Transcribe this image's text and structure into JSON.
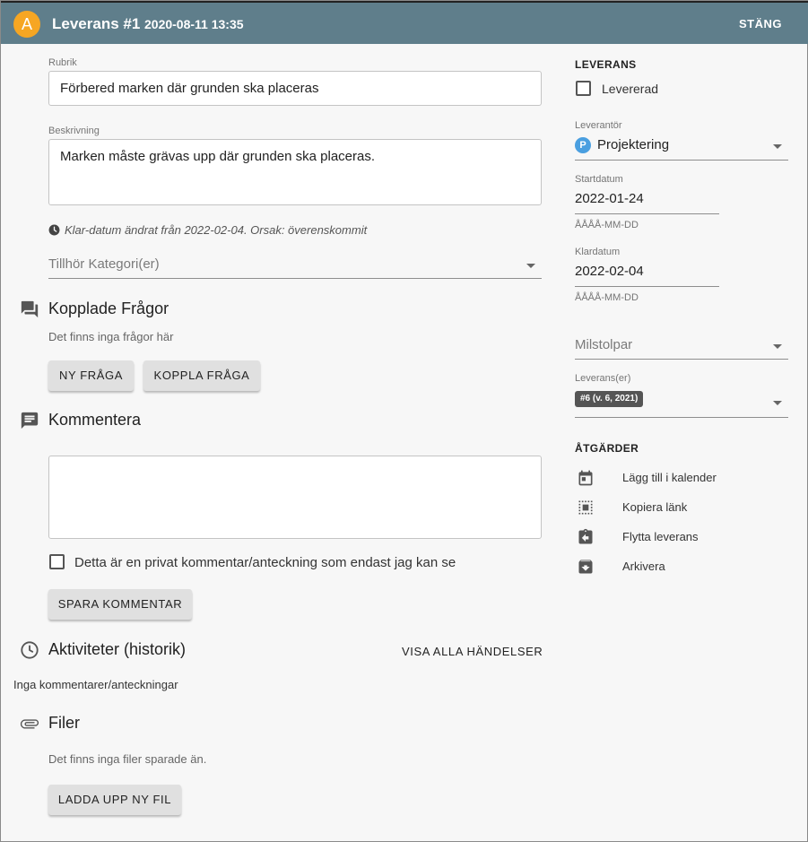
{
  "header": {
    "avatar_letter": "A",
    "title": "Leverans #1",
    "datetime": "2020-08-11 13:35",
    "close_label": "STÄNG"
  },
  "form": {
    "rubrik_label": "Rubrik",
    "rubrik_value": "Förbered marken där grunden ska placeras",
    "beskrivning_label": "Beskrivning",
    "beskrivning_value": "Marken måste grävas upp där grunden ska placeras.",
    "date_change_note": "Klar-datum ändrat från 2022-02-04. Orsak: överenskommit",
    "kategori_placeholder": "Tillhör Kategori(er)"
  },
  "fragor": {
    "title": "Kopplade Frågor",
    "empty_text": "Det finns inga frågor här",
    "new_button": "NY FRÅGA",
    "link_button": "KOPPLA FRÅGA"
  },
  "kommentera": {
    "title": "Kommentera",
    "comment_value": "",
    "private_label": "Detta är en privat kommentar/anteckning som endast jag kan se",
    "save_button": "SPARA KOMMENTAR"
  },
  "aktiviteter": {
    "title": "Aktiviteter (historik)",
    "show_all_button": "VISA ALLA HÄNDELSER",
    "empty_text": "Inga kommentarer/anteckningar"
  },
  "filer": {
    "title": "Filer",
    "empty_text": "Det finns inga filer sparade än.",
    "upload_button": "LADDA UPP NY FIL"
  },
  "leverans": {
    "heading": "LEVERANS",
    "delivered_label": "Levererad",
    "supplier_label": "Leverantör",
    "supplier_badge": "P",
    "supplier_value": "Projektering",
    "start_label": "Startdatum",
    "start_value": "2022-01-24",
    "start_hint": "ÅÅÅÅ-MM-DD",
    "end_label": "Klardatum",
    "end_value": "2022-02-04",
    "end_hint": "ÅÅÅÅ-MM-DD",
    "milestone_placeholder": "Milstolpar",
    "deliveries_label": "Leverans(er)",
    "delivery_chip": "#6 (v. 6, 2021)"
  },
  "atgarder": {
    "heading": "ÅTGÄRDER",
    "items": [
      {
        "label": "Lägg till i kalender",
        "icon": "calendar-icon"
      },
      {
        "label": "Kopiera länk",
        "icon": "copy-link-icon"
      },
      {
        "label": "Flytta leverans",
        "icon": "move-icon"
      },
      {
        "label": "Arkivera",
        "icon": "archive-icon"
      }
    ]
  },
  "colors": {
    "header_bg": "#5f7e8b",
    "avatar": "#f6a623",
    "supplier_dot": "#4a9fe0",
    "button_bg": "#e0e0e0"
  }
}
